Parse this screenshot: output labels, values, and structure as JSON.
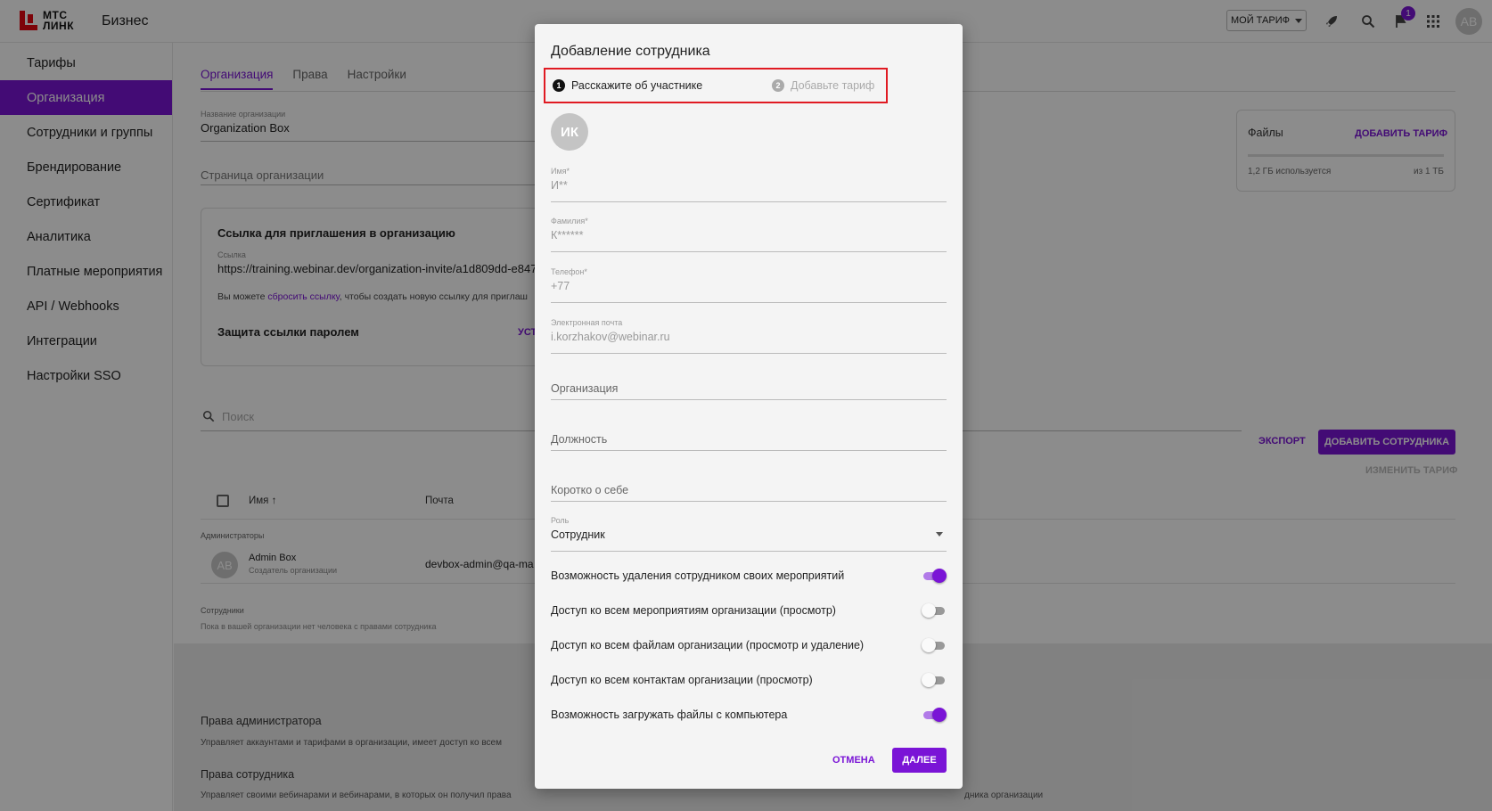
{
  "topbar": {
    "logo_text_line1": "МТС",
    "logo_text_line2": "ЛИНК",
    "brand_suffix": "Бизнес",
    "tariff_button": "МОЙ ТАРИФ",
    "notification_count": "1",
    "avatar_initials": "AB"
  },
  "sidebar": {
    "items": [
      {
        "label": "Тарифы"
      },
      {
        "label": "Организация"
      },
      {
        "label": "Сотрудники и группы"
      },
      {
        "label": "Брендирование"
      },
      {
        "label": "Сертификат"
      },
      {
        "label": "Аналитика"
      },
      {
        "label": "Платные мероприятия"
      },
      {
        "label": "API / Webhooks"
      },
      {
        "label": "Интеграции"
      },
      {
        "label": "Настройки SSO"
      }
    ]
  },
  "main": {
    "tabs": [
      {
        "label": "Организация"
      },
      {
        "label": "Права"
      },
      {
        "label": "Настройки"
      }
    ],
    "org_name_label": "Название организации",
    "org_name_value": "Organization Box",
    "org_page_label": "Страница организации",
    "invite_card": {
      "title": "Ссылка для приглашения в организацию",
      "link_label": "Ссылка",
      "link_value": "https://training.webinar.dev/organization-invite/a1d809dd-e847-4",
      "hint_before": "Вы можете",
      "hint_link": "сбросить ссылку",
      "hint_after": ", чтобы создать новую ссылку для приглаш",
      "password_title": "Защита ссылки паролем",
      "password_action": "УСТ"
    },
    "files_card": {
      "title": "Файлы",
      "add_tariff": "ДОБАВИТЬ ТАРИФ",
      "used": "1,2 ГБ используется",
      "total": "из 1 ТБ"
    },
    "search_placeholder": "Поиск",
    "export_label": "ЭКСПОРТ",
    "add_employee_label": "ДОБАВИТЬ СОТРУДНИКА",
    "change_tariff_label": "ИЗМЕНИТЬ ТАРИФ",
    "table": {
      "col_name": "Имя",
      "col_email": "Почта",
      "admins_label": "Администраторы",
      "admin_initials": "AB",
      "admin_name": "Admin Box",
      "admin_role": "Создатель организации",
      "admin_email": "devbox-admin@qa-ma",
      "employees_label": "Сотрудники",
      "employees_empty": "Пока в вашей организации нет человека с правами сотрудника"
    },
    "rights": {
      "admin_title": "Права администратора",
      "admin_desc": "Управляет аккаунтами и тарифами в организации, имеет доступ ко всем",
      "employee_title": "Права сотрудника",
      "employee_desc": "Управляет своими вебинарами и вебинарами, в которых он получил права",
      "employee_desc_tail": "дника организации"
    }
  },
  "modal": {
    "title": "Добавление сотрудника",
    "steps": [
      {
        "num": "1",
        "label": "Расскажите об участнике"
      },
      {
        "num": "2",
        "label": "Добавьте тариф"
      }
    ],
    "avatar_initials": "ИК",
    "fields": {
      "first_name": {
        "label": "Имя*",
        "value": "И**"
      },
      "last_name": {
        "label": "Фамилия*",
        "value": "К******"
      },
      "phone": {
        "label": "Телефон*",
        "value": "+77"
      },
      "email": {
        "label": "Электронная почта",
        "value": "i.korzhakov@webinar.ru"
      },
      "organization": {
        "placeholder": "Организация"
      },
      "position": {
        "placeholder": "Должность"
      },
      "about": {
        "placeholder": "Коротко о себе"
      },
      "role": {
        "label": "Роль",
        "value": "Сотрудник"
      }
    },
    "toggles": [
      {
        "label": "Возможность удаления сотрудником своих мероприятий",
        "on": true
      },
      {
        "label": "Доступ ко всем мероприятиям организации (просмотр)",
        "on": false
      },
      {
        "label": "Доступ ко всем файлам организации (просмотр и удаление)",
        "on": false
      },
      {
        "label": "Доступ ко всем контактам организации (просмотр)",
        "on": false
      },
      {
        "label": "Возможность загружать файлы с компьютера",
        "on": true
      }
    ],
    "cancel_label": "ОТМЕНА",
    "next_label": "ДАЛЕЕ"
  },
  "colors": {
    "accent": "#7a14d6",
    "brand_red": "#e30611",
    "highlight_border": "#e01a22"
  }
}
